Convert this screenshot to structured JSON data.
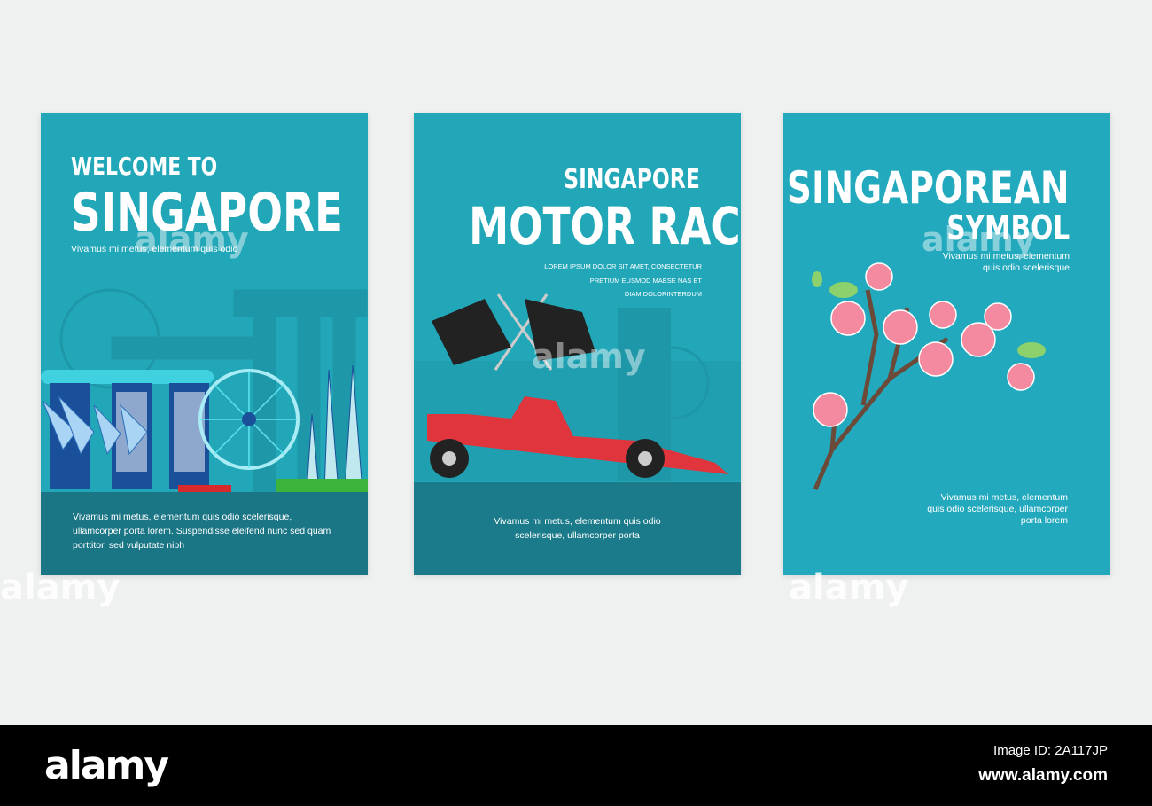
{
  "cards": [
    {
      "pre_title": "WELCOME TO",
      "title": "SINGAPORE",
      "subtitle": "Vivamus mi metus, elementum quis odio",
      "body": "Vivamus mi metus, elementum quis odio scelerisque, ullamcorper porta lorem. Suspendisse eleifend nunc sed quam porttitor, sed vulputate nibh"
    },
    {
      "pre_title": "SINGAPORE",
      "title": "MOTOR RACE",
      "caps_lines": [
        "LOREM IPSUM DOLOR SIT AMET, CONSECTETUR",
        "PRETIUM EUSMOD MAESE NAS ET",
        "DIAM DOLORINTERDUM"
      ],
      "body_lines": [
        "Vivamus mi metus, elementum quis odio",
        "scelerisque, ullamcorper porta"
      ]
    },
    {
      "title": "SINGAPOREAN",
      "post_title": "SYMBOL",
      "top_lines": [
        "Vivamus mi metus, elementum",
        "quis odio scelerisque"
      ],
      "bottom_lines": [
        "Vivamus mi metus, elementum",
        "quis odio scelerisque, ullamcorper",
        "porta lorem"
      ]
    }
  ],
  "watermark": {
    "brand": "alamy",
    "image_id": "Image ID: 2A117JP",
    "url": "www.alamy.com"
  },
  "colors": {
    "card": "#22a7b9",
    "band": "#1a7585",
    "background": "#eff0f0"
  }
}
